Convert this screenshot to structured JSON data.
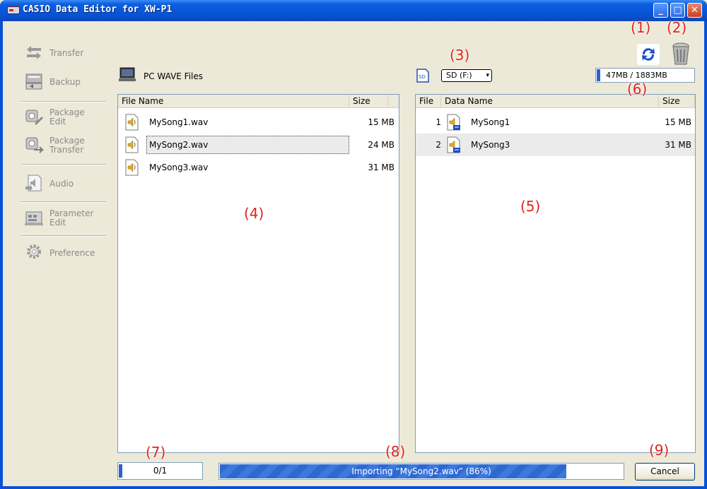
{
  "window": {
    "title": "CASIO Data Editor for XW-P1",
    "buttons": [
      "minimize",
      "maximize",
      "close"
    ]
  },
  "sidebar": {
    "items": [
      {
        "label": "Transfer",
        "icon": "transfer-arrows-icon"
      },
      {
        "label": "Backup",
        "icon": "backup-icon"
      },
      {
        "label": "Package\nEdit",
        "icon": "package-edit-icon"
      },
      {
        "label": "Package\nTransfer",
        "icon": "package-transfer-icon"
      },
      {
        "label": "Audio",
        "icon": "audio-icon"
      },
      {
        "label": "Parameter\nEdit",
        "icon": "parameter-edit-icon"
      },
      {
        "label": "Preference",
        "icon": "gear-icon"
      }
    ]
  },
  "pc_panel": {
    "title": "PC WAVE Files",
    "columns": [
      "File Name",
      "Size"
    ],
    "rows": [
      {
        "name": "MySong1.wav",
        "size": "15 MB"
      },
      {
        "name": "MySong2.wav",
        "size": "24 MB"
      },
      {
        "name": "MySong3.wav",
        "size": "31 MB"
      }
    ]
  },
  "sd_panel": {
    "drive_select": "SD (F:)",
    "capacity": "47MB / 1883MB",
    "capacity_fraction": 0.025,
    "columns": [
      "File",
      "Data Name",
      "Size"
    ],
    "rows": [
      {
        "file": "1",
        "name": "MySong1",
        "size": "15 MB"
      },
      {
        "file": "2",
        "name": "MySong3",
        "size": "31 MB"
      }
    ]
  },
  "status": {
    "count": "0/1",
    "count_fraction": 0.04,
    "progress_text": "Importing “MySong2.wav”    (86%)",
    "progress_fraction": 0.86,
    "cancel_label": "Cancel"
  },
  "annotations": {
    "a1": "(1)",
    "a2": "(2)",
    "a3": "(3)",
    "a4": "(4)",
    "a5": "(5)",
    "a6": "(6)",
    "a7": "(7)",
    "a8": "(8)",
    "a9": "(9)"
  },
  "colors": {
    "titlebar": "#0852d6",
    "progress": "#2e69cf",
    "annotation": "#e0231b",
    "selected_row": "#ebebeb"
  }
}
